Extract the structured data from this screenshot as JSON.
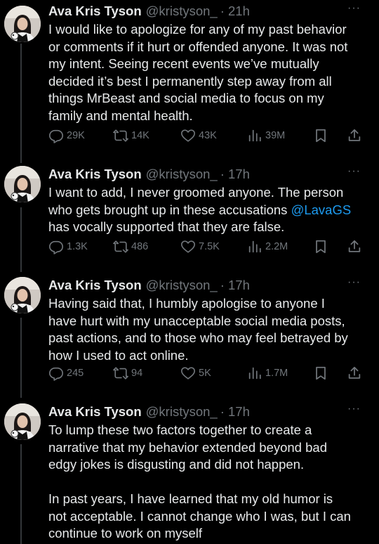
{
  "tweets": [
    {
      "name": "Ava Kris Tyson",
      "handle": "@kristyson_",
      "time": "· 21h",
      "more": "···",
      "lines": [
        "I would like to apologize for any of my past behavior",
        "or comments if it hurt or offended anyone. It was not",
        "my intent. Seeing recent events we’ve mutually",
        "decided it’s best I permanently step away from all",
        "things MrBeast and social media to focus on my",
        "family and mental health."
      ],
      "replies": "29K",
      "reposts": "14K",
      "likes": "43K",
      "views": "39M"
    },
    {
      "name": "Ava Kris Tyson",
      "handle": "@kristyson_",
      "time": "· 17h",
      "more": "···",
      "lines": [
        "I want to add, I never groomed anyone. The person",
        "who gets brought up in these accusations ",
        "has vocally supported that they are false."
      ],
      "mention": "@LavaGS",
      "replies": "1.3K",
      "reposts": "486",
      "likes": "7.5K",
      "views": "2.2M"
    },
    {
      "name": "Ava Kris Tyson",
      "handle": "@kristyson_",
      "time": "· 17h",
      "more": "···",
      "lines": [
        "Having said that, I humbly apologise to anyone I",
        "have hurt with my unacceptable social media posts,",
        "past actions, and to those who may feel betrayed by",
        "how I used to act online."
      ],
      "replies": "245",
      "reposts": "94",
      "likes": "5K",
      "views": "1.7M"
    },
    {
      "name": "Ava Kris Tyson",
      "handle": "@kristyson_",
      "time": "· 17h",
      "more": "···",
      "lines": [
        "To lump these two factors together to create a",
        "narrative that my behavior extended beyond bad",
        "edgy jokes is disgusting and did not happen.",
        "",
        "In past years, I have learned that my old humor is",
        "not acceptable. I cannot change who I was, but I can",
        "continue to work on myself"
      ]
    }
  ]
}
